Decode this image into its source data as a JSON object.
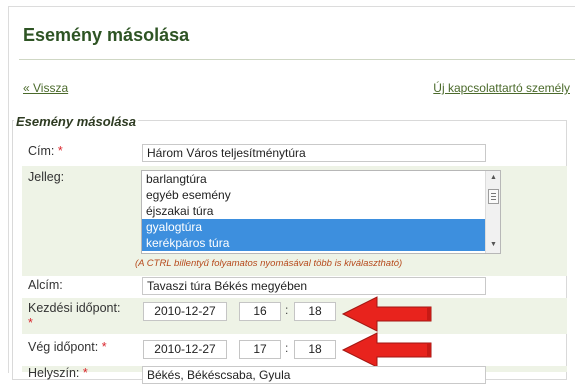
{
  "page": {
    "title": "Esemény másolása",
    "back_link": "« Vissza",
    "new_contact_link": "Új kapcsolattartó személy"
  },
  "form": {
    "legend": "Esemény másolása",
    "required_mark": "*",
    "title_label": "Cím:",
    "title_value": "Három Város teljesítménytúra",
    "type_label": "Jelleg:",
    "type_options": [
      {
        "label": "barlangtúra",
        "selected": false
      },
      {
        "label": "egyéb esemény",
        "selected": false
      },
      {
        "label": "éjszakai túra",
        "selected": false
      },
      {
        "label": "gyalogtúra",
        "selected": true
      },
      {
        "label": "kerékpáros túra",
        "selected": true
      }
    ],
    "multi_select_hint": "(A CTRL billentyű folyamatos nyomásával több is kiválasztható)",
    "subtitle_label": "Alcím:",
    "subtitle_value": "Tavaszi túra Békés megyében",
    "start_label": "Kezdési időpont:",
    "start_date": "2010-12-27",
    "start_hour": "16",
    "start_minute": "18",
    "end_label": "Vég időpont:",
    "end_date": "2010-12-27",
    "end_hour": "17",
    "end_minute": "18",
    "location_label": "Helyszín:",
    "location_value": "Békés, Békéscsaba, Gyula",
    "time_separator": ":"
  },
  "colors": {
    "title_green": "#2e5424",
    "row_shade": "#eef3e6",
    "selected_option": "#3d8fde",
    "required_red": "#d9242b",
    "arrow_red": "#e8231d"
  }
}
